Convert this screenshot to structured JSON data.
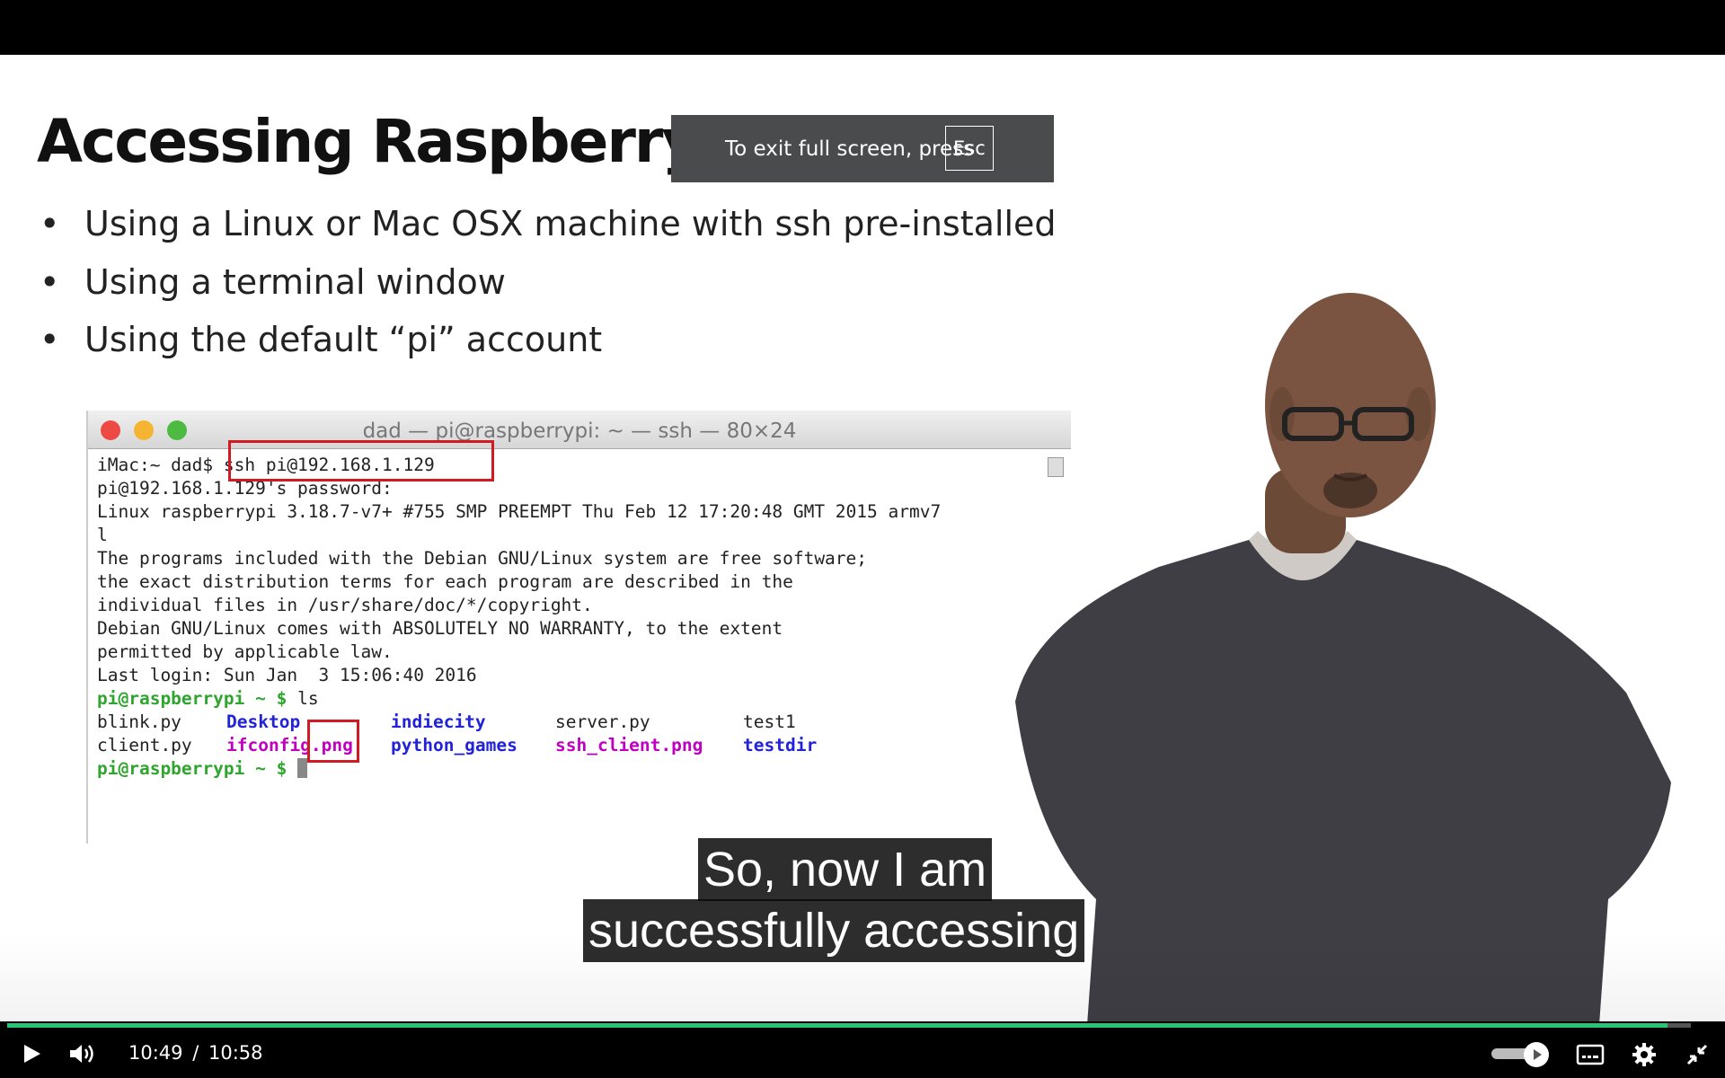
{
  "fullscreen_notice": {
    "text": "To exit full screen, press",
    "key": "Esc"
  },
  "slide": {
    "title": "Accessing Raspberry Pi w/ SSH",
    "bullets": [
      "Using a Linux or Mac OSX machine with ssh pre-installed",
      "Using a terminal window",
      "Using the default “pi” account"
    ],
    "terminal": {
      "title": "dad — pi@raspberrypi: ~ — ssh — 80×24",
      "lines": [
        "iMac:~ dad$ ssh pi@192.168.1.129",
        "pi@192.168.1.129's password:",
        "Linux raspberrypi 3.18.7-v7+ #755 SMP PREEMPT Thu Feb 12 17:20:48 GMT 2015 armv7",
        "l",
        "",
        "The programs included with the Debian GNU/Linux system are free software;",
        "the exact distribution terms for each program are described in the",
        "individual files in /usr/share/doc/*/copyright.",
        "",
        "Debian GNU/Linux comes with ABSOLUTELY NO WARRANTY, to the extent",
        "permitted by applicable law.",
        "Last login: Sun Jan  3 15:06:40 2016"
      ],
      "prompt": "pi@raspberrypi ~ $",
      "command": "ls",
      "files": {
        "row1": [
          "blink.py",
          "Desktop",
          "indiecity",
          "server.py",
          "test1"
        ],
        "row2": [
          "client.py",
          "ifconfig.png",
          "python_games",
          "ssh_client.png",
          "testdir"
        ]
      },
      "colors": {
        "prompt": "#2fa52f",
        "dir": "#2222d8",
        "image": "#c000c0",
        "highlight": "#d01b24"
      }
    }
  },
  "captions": [
    "So, now I am",
    "successfully accessing"
  ],
  "player": {
    "current_time": "10:49",
    "separator": "/",
    "duration": "10:58",
    "progress": 0.986,
    "volume": 0.8,
    "icons": [
      "play-icon",
      "volume-icon",
      "subtitles-icon",
      "settings-icon",
      "exit-fullscreen-icon"
    ],
    "accent": "#2ac573"
  }
}
